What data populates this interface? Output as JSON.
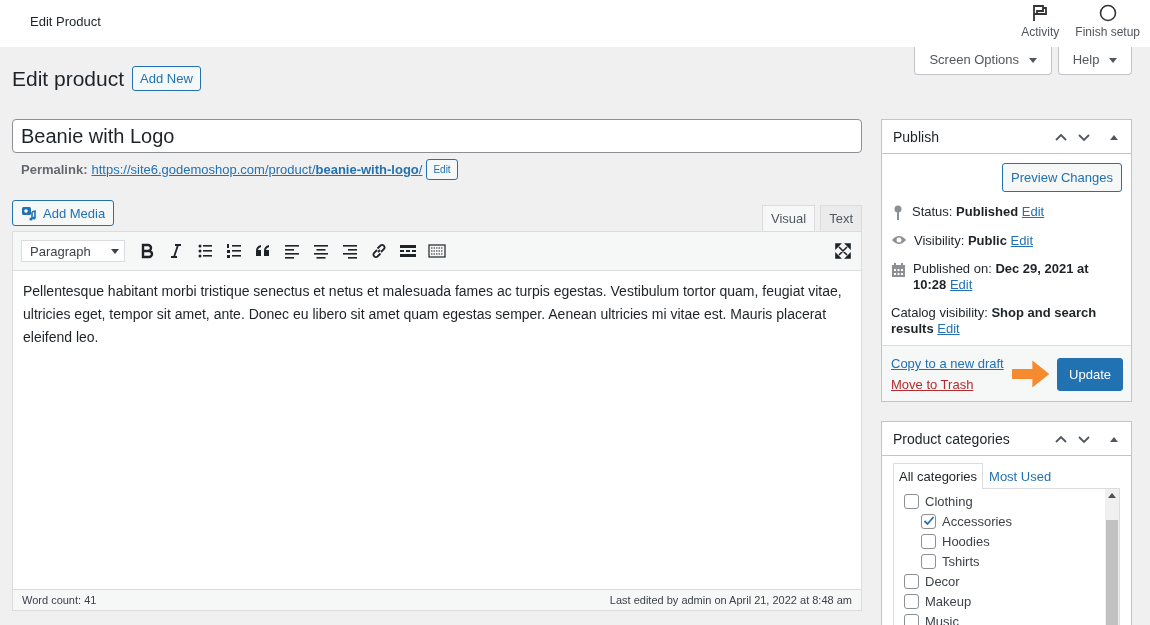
{
  "topbar": {
    "title": "Edit Product",
    "actions": [
      {
        "kind": "flag",
        "label": "Activity"
      },
      {
        "kind": "circle",
        "label": "Finish setup"
      }
    ]
  },
  "screen_tabs": [
    {
      "label": "Screen Options"
    },
    {
      "label": "Help"
    }
  ],
  "heading": {
    "title": "Edit product",
    "add_new": "Add New"
  },
  "post_title": {
    "value": "Beanie with Logo"
  },
  "permalink": {
    "label": "Permalink:",
    "url": "https://site6.godemoshop.com/product/**beanie-with-logo**/",
    "edit": "Edit"
  },
  "editor": {
    "add_media": "Add Media",
    "tabs": [
      {
        "label": "Visual",
        "selected": true
      },
      {
        "label": "Text",
        "selected": false
      }
    ],
    "format": "Paragraph",
    "tools": [
      {
        "kind": "bold"
      },
      {
        "kind": "italic"
      },
      {
        "kind": "bullets"
      },
      {
        "kind": "numbers"
      },
      {
        "kind": "quote"
      },
      {
        "kind": "align-left"
      },
      {
        "kind": "align-center"
      },
      {
        "kind": "align-right"
      },
      {
        "kind": "link"
      },
      {
        "kind": "more"
      },
      {
        "kind": "toolbar"
      }
    ],
    "content": "Pellentesque habitant morbi tristique senectus et netus et malesuada fames ac turpis egestas. Vestibulum tortor quam, feugiat vitae, ultricies eget, tempor sit amet, ante. Donec eu libero sit amet quam egestas semper. Aenean ultricies mi vitae est. Mauris placerat eleifend leo.",
    "word_count": "Word count: 41",
    "last_edited": "Last edited by admin on April 21, 2022 at 8:48 am"
  },
  "publish": {
    "title": "Publish",
    "preview": "Preview Changes",
    "items": [
      {
        "kind": "pin",
        "text": "Status: **Published**",
        "edit": "Edit"
      },
      {
        "kind": "eye",
        "text": "Visibility: **Public**",
        "edit": "Edit"
      },
      {
        "kind": "calendar",
        "text": "Published on: **Dec 29, 2021 at 10:28**",
        "edit": "Edit"
      },
      {
        "kind": "none",
        "text": "Catalog visibility: **Shop and search results**",
        "edit": "Edit"
      }
    ],
    "copy": "Copy to a new draft",
    "trash": "Move to Trash",
    "update": "Update"
  },
  "categories": {
    "title": "Product categories",
    "tabs": [
      {
        "label": "All categories",
        "selected": true
      },
      {
        "label": "Most Used",
        "selected": false
      }
    ],
    "items": [
      {
        "label": "Clothing",
        "checked": false,
        "children": [
          {
            "label": "Accessories",
            "checked": true
          },
          {
            "label": "Hoodies",
            "checked": false
          },
          {
            "label": "Tshirts",
            "checked": false
          }
        ]
      },
      {
        "label": "Decor",
        "checked": false
      },
      {
        "label": "Makeup",
        "checked": false
      },
      {
        "label": "Music",
        "checked": false
      }
    ]
  }
}
